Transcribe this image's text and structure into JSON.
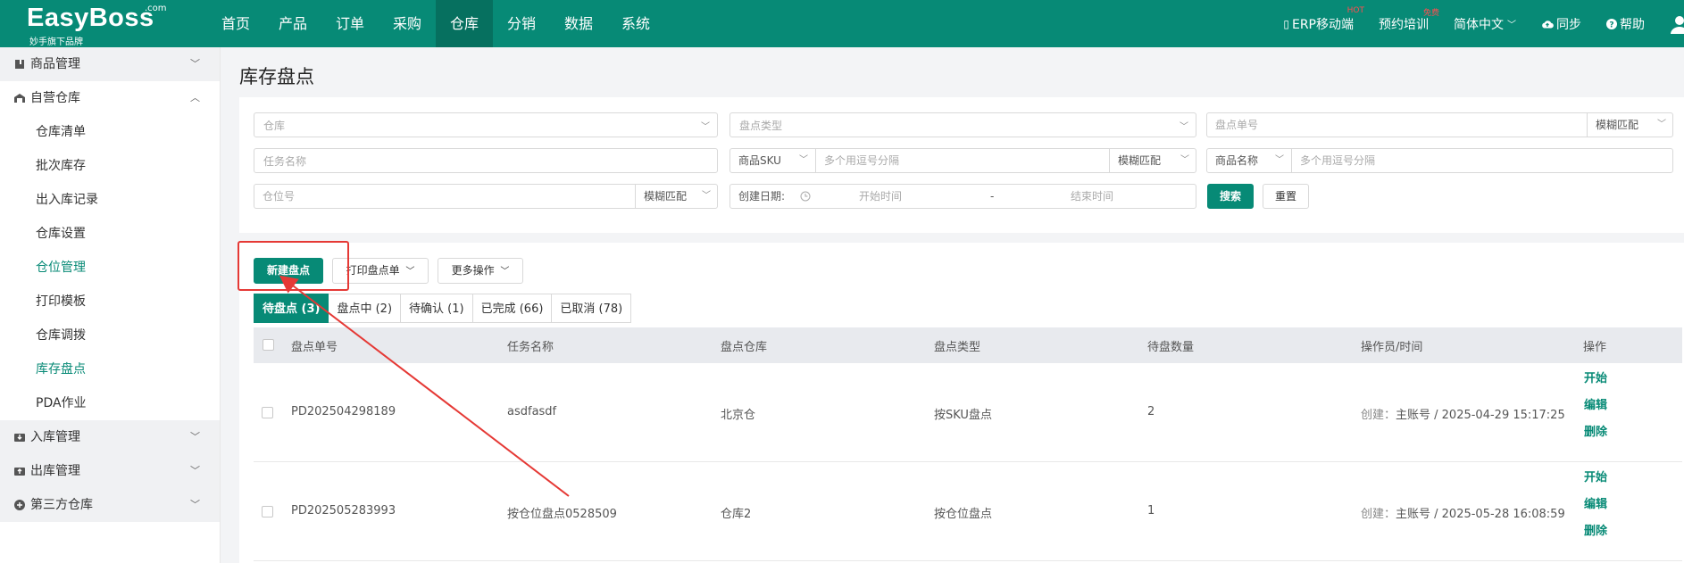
{
  "logo": {
    "brand": "EasyBoss",
    "com": ".com",
    "tagline": "妙手旗下品牌"
  },
  "nav": {
    "items": [
      "首页",
      "产品",
      "订单",
      "采购",
      "仓库",
      "分销",
      "数据",
      "系统"
    ],
    "active": "仓库"
  },
  "tools": {
    "erp": "ERP移动端",
    "erp_sup": "HOT",
    "training": "预约培训",
    "training_sup": "免费",
    "language": "简体中文",
    "sync": "同步",
    "help": "帮助"
  },
  "sidebar": {
    "groups": [
      {
        "label": "商品管理",
        "icon": "product-icon"
      },
      {
        "label": "自营仓库",
        "icon": "warehouse-icon",
        "expanded": true
      },
      {
        "label": "入库管理",
        "icon": "inbound-icon"
      },
      {
        "label": "出库管理",
        "icon": "outbound-icon"
      },
      {
        "label": "第三方仓库",
        "icon": "third-party-icon"
      }
    ],
    "sub_items": [
      {
        "label": "仓库清单"
      },
      {
        "label": "批次库存"
      },
      {
        "label": "出入库记录"
      },
      {
        "label": "仓库设置"
      },
      {
        "label": "仓位管理",
        "highlight": true
      },
      {
        "label": "打印模板"
      },
      {
        "label": "仓库调拨"
      },
      {
        "label": "库存盘点",
        "highlight": true
      },
      {
        "label": "PDA作业"
      }
    ]
  },
  "page": {
    "title": "库存盘点"
  },
  "filters": {
    "warehouse_placeholder": "仓库",
    "type_placeholder": "盘点类型",
    "order_no_placeholder": "盘点单号",
    "fuzzy": "模糊匹配",
    "task_placeholder": "任务名称",
    "sku_label": "商品SKU",
    "multi_placeholder": "多个用逗号分隔",
    "product_name_label": "商品名称",
    "location_placeholder": "仓位号",
    "created_label": "创建日期:",
    "start_placeholder": "开始时间",
    "dash": "-",
    "end_placeholder": "结束时间",
    "search": "搜索",
    "reset": "重置"
  },
  "actions": {
    "new": "新建盘点",
    "print": "打印盘点单",
    "more": "更多操作"
  },
  "tabs": [
    "待盘点 (3)",
    "盘点中 (2)",
    "待确认 (1)",
    "已完成 (66)",
    "已取消 (78)"
  ],
  "table": {
    "headers": [
      "盘点单号",
      "任务名称",
      "盘点仓库",
      "盘点类型",
      "待盘数量",
      "操作员/时间",
      "操作"
    ],
    "rows": [
      {
        "no": "PD202504298189",
        "task": "asdfasdf",
        "warehouse": "北京仓",
        "type": "按SKU盘点",
        "qty": "2",
        "created_label": "创建：",
        "operator": "主账号 / 2025-04-29 15:17:25",
        "ops": [
          "开始",
          "编辑",
          "删除"
        ]
      },
      {
        "no": "PD202505283993",
        "task": "按仓位盘点0528509",
        "warehouse": "仓库2",
        "type": "按仓位盘点",
        "qty": "1",
        "created_label": "创建：",
        "operator": "主账号 / 2025-05-28 16:08:59",
        "ops": [
          "开始",
          "编辑",
          "删除"
        ]
      }
    ]
  },
  "colors": {
    "brand": "#078a76",
    "annotation": "#e53935"
  }
}
